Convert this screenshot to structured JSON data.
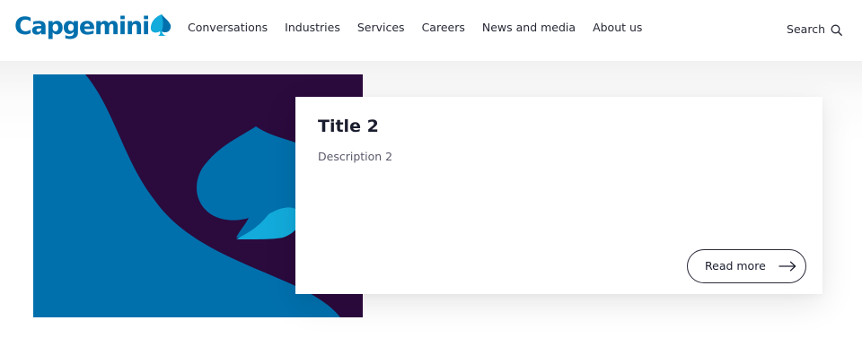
{
  "header": {
    "logo_text": "Capgemini",
    "nav": [
      "Conversations",
      "Industries",
      "Services",
      "Careers",
      "News and media",
      "About us"
    ],
    "search_label": "Search",
    "icons": {
      "logo": "spade-logo-icon",
      "search": "search-icon"
    }
  },
  "card": {
    "title": "Title 2",
    "description": "Description 2",
    "cta_label": "Read more",
    "cta_icon": "arrow-right-icon"
  },
  "colors": {
    "brand_blue": "#0070ad",
    "light_blue": "#12abdb",
    "dark_purple": "#2b0a3d",
    "text": "#272936"
  }
}
